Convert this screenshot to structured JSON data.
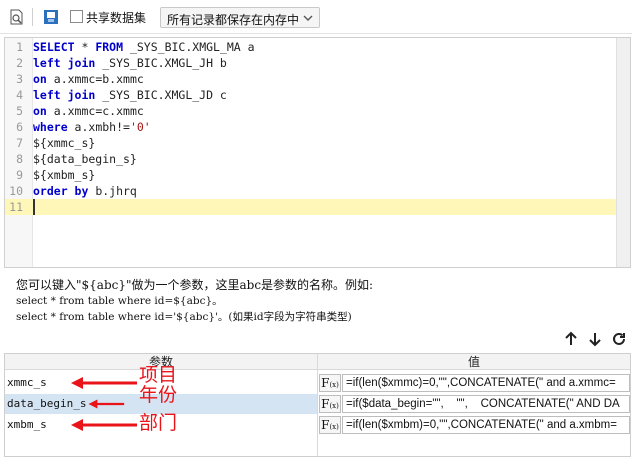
{
  "toolbar": {
    "share_label": "共享数据集",
    "mode_select": "所有记录都保存在内存中"
  },
  "editor": {
    "lines": [
      {
        "n": "1",
        "parts": [
          [
            "kw",
            "SELECT"
          ],
          [
            "",
            " * "
          ],
          [
            "kw",
            "FROM"
          ],
          [
            "",
            " _SYS_BIC.XMGL_MA a"
          ]
        ]
      },
      {
        "n": "2",
        "parts": [
          [
            "kw",
            "left join"
          ],
          [
            "",
            " _SYS_BIC.XMGL_JH b"
          ]
        ]
      },
      {
        "n": "3",
        "parts": [
          [
            "kw",
            "on"
          ],
          [
            "",
            " a.xmmc=b.xmmc"
          ]
        ]
      },
      {
        "n": "4",
        "parts": [
          [
            "kw",
            "left join"
          ],
          [
            "",
            " _SYS_BIC.XMGL_JD c"
          ]
        ]
      },
      {
        "n": "5",
        "parts": [
          [
            "kw",
            "on"
          ],
          [
            "",
            " a.xmmc=c.xmmc"
          ]
        ]
      },
      {
        "n": "6",
        "parts": [
          [
            "kw",
            "where"
          ],
          [
            "",
            " a.xmbh!="
          ],
          [
            "str",
            "'0'"
          ]
        ]
      },
      {
        "n": "7",
        "parts": [
          [
            "",
            "${xmmc_s}"
          ]
        ]
      },
      {
        "n": "8",
        "parts": [
          [
            "",
            "${data_begin_s}"
          ]
        ]
      },
      {
        "n": "9",
        "parts": [
          [
            "",
            "${xmbm_s}"
          ]
        ]
      },
      {
        "n": "10",
        "parts": [
          [
            "kw",
            "order by"
          ],
          [
            "",
            " b.jhrq"
          ]
        ]
      },
      {
        "n": "11",
        "parts": [
          [
            "",
            ""
          ]
        ]
      }
    ]
  },
  "help": {
    "line1": "您可以键入\"${abc}\"做为一个参数，这里abc是参数的名称。例如:",
    "line2": "select * from table where id=${abc}。",
    "line3": "select * from table where id='${abc}'。(如果id字段为字符串类型)"
  },
  "params": {
    "header_name": "参数",
    "header_value": "值",
    "fx_label": "F",
    "fx_sub": "(x)",
    "rows": [
      {
        "name": "xmmc_s",
        "value": "=if(len($xmmc)=0,\"\",CONCATENATE(\" and a.xmmc=",
        "note": "项目"
      },
      {
        "name": "data_begin_s",
        "value": "=if($data_begin=\"\",    \"\",    CONCATENATE(\" AND DA",
        "note": "年份"
      },
      {
        "name": "xmbm_s",
        "value": "=if(len($xmbm)=0,\"\",CONCATENATE(\" and a.xmbm=",
        "note": "部门"
      }
    ]
  },
  "colors": {
    "keyword": "#0000cc",
    "string": "#a31515",
    "annotation": "#e8141a",
    "active_line": "#fff7b8",
    "selected_row": "#d5e4f3"
  }
}
